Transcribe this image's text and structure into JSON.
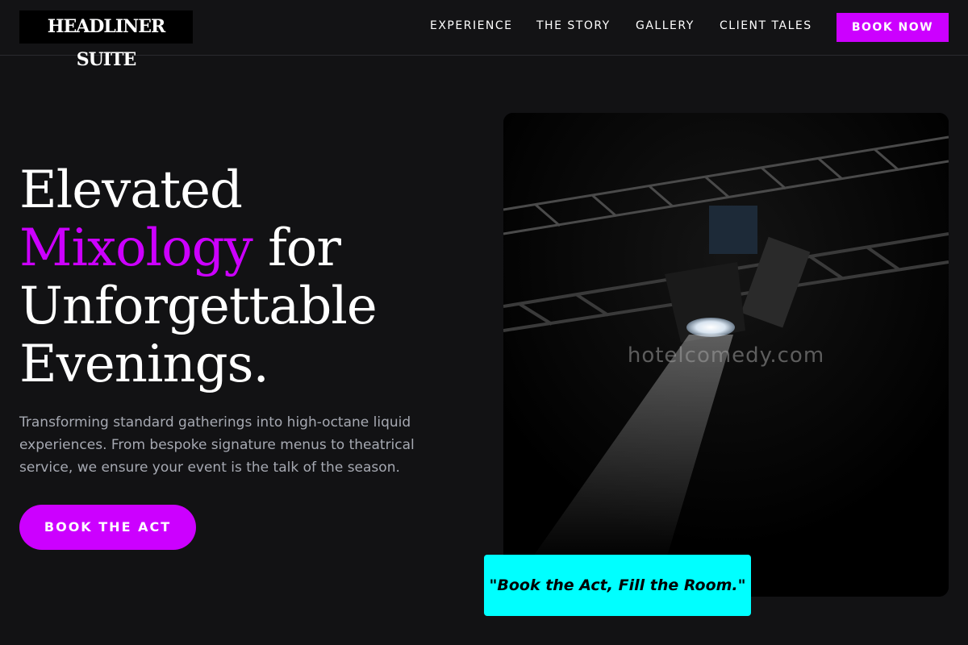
{
  "nav": {
    "logo": "HEADLINER SUITE",
    "links": [
      "EXPERIENCE",
      "THE STORY",
      "GALLERY",
      "CLIENT TALES"
    ],
    "book_label": "BOOK NOW"
  },
  "hero": {
    "title_line1": "Elevated",
    "title_accent": "Mixology",
    "title_after_accent": " for",
    "title_line3": "Unforgettable",
    "title_line4": "Evenings.",
    "description": "Transforming standard gatherings into high-octane liquid experiences. From bespoke signature menus to theatrical service, we ensure your event is the talk of the season.",
    "cta_label": "BOOK THE ACT"
  },
  "photo": {
    "watermark": "hotelcomedy.com"
  },
  "quote": {
    "text": "\"Book the Act, Fill the Room.\""
  },
  "colors": {
    "background": "#121214",
    "accent": "#cc00ff",
    "quote_bg": "#00ffff",
    "muted_text": "#a6a9b2"
  },
  "icons": [
    "stage-spotlight-image"
  ]
}
